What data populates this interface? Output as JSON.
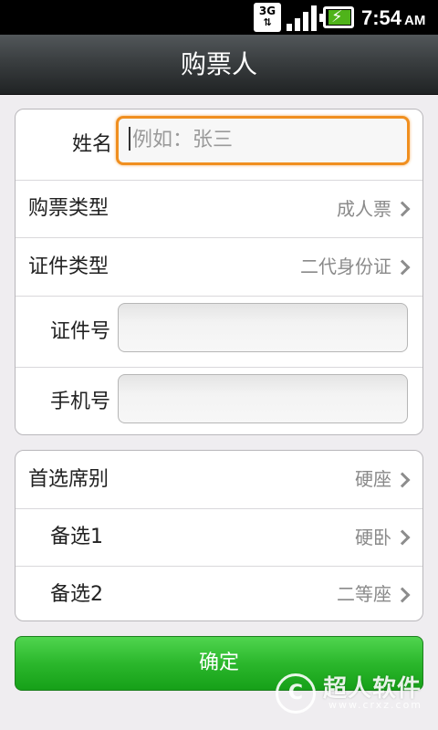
{
  "status_bar": {
    "network": "3G",
    "network_arrows": "⇅",
    "time": "7:54",
    "ampm": "AM"
  },
  "header": {
    "title": "购票人"
  },
  "form": {
    "name_label": "姓名",
    "name_placeholder": "例如：张三",
    "ticket_type_label": "购票类型",
    "ticket_type_value": "成人票",
    "id_type_label": "证件类型",
    "id_type_value": "二代身份证",
    "id_number_label": "证件号",
    "phone_label": "手机号"
  },
  "seats": {
    "preferred_label": "首选席别",
    "preferred_value": "硬座",
    "alt1_label": "备选1",
    "alt1_value": "硬卧",
    "alt2_label": "备选2",
    "alt2_value": "二等座"
  },
  "confirm_label": "确定",
  "watermark": {
    "logo": "C",
    "name": "超人软件",
    "url": "www.crxz.com"
  }
}
